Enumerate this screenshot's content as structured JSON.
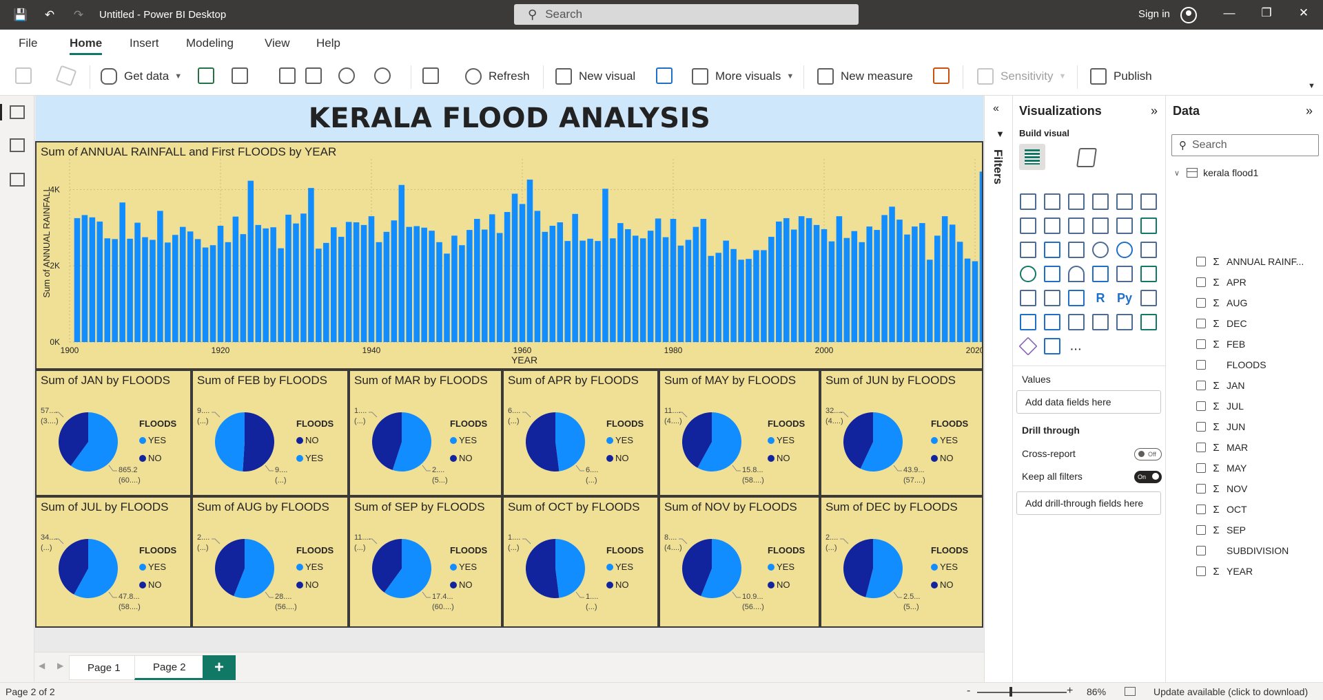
{
  "window": {
    "title": "Untitled - Power BI Desktop",
    "search_placeholder": "Search",
    "sign_in": "Sign in",
    "minimize": "—",
    "restore": "❐",
    "close": "✕"
  },
  "menu": [
    "File",
    "Home",
    "Insert",
    "Modeling",
    "View",
    "Help"
  ],
  "ribbon": {
    "get_data": "Get data",
    "refresh": "Refresh",
    "new_visual": "New visual",
    "more_visuals": "More visuals",
    "new_measure": "New measure",
    "sensitivity": "Sensitivity",
    "publish": "Publish"
  },
  "report": {
    "banner": "KERALA FLOOD ANALYSIS",
    "bar_visual": {
      "title": "Sum of ANNUAL RAINFALL and First FLOODS by YEAR"
    },
    "pies": [
      {
        "title": "Sum of JAN by FLOODS",
        "legend_title": "FLOODS",
        "legend": [
          "YES",
          "NO"
        ],
        "label_a": [
          "57....",
          "(3....)"
        ],
        "label_b": [
          "865.2",
          "(60....)"
        ]
      },
      {
        "title": "Sum of FEB by FLOODS",
        "legend_title": "FLOODS",
        "legend": [
          "NO",
          "YES"
        ],
        "label_a": [
          "9....",
          "(...)"
        ],
        "label_b": [
          "9....",
          "(...)"
        ]
      },
      {
        "title": "Sum of MAR by FLOODS",
        "legend_title": "FLOODS",
        "legend": [
          "YES",
          "NO"
        ],
        "label_a": [
          "1....",
          "(...)"
        ],
        "label_b": [
          "2....",
          "(5...)"
        ]
      },
      {
        "title": "Sum of APR by FLOODS",
        "legend_title": "FLOODS",
        "legend": [
          "YES",
          "NO"
        ],
        "label_a": [
          "6....",
          "(...)"
        ],
        "label_b": [
          "6....",
          "(...)"
        ]
      },
      {
        "title": "Sum of MAY by FLOODS",
        "legend_title": "FLOODS",
        "legend": [
          "YES",
          "NO"
        ],
        "label_a": [
          "11....",
          "(4....)"
        ],
        "label_b": [
          "15.8...",
          "(58....)"
        ]
      },
      {
        "title": "Sum of JUN by FLOODS",
        "legend_title": "FLOODS",
        "legend": [
          "YES",
          "NO"
        ],
        "label_a": [
          "32....",
          "(4....)"
        ],
        "label_b": [
          "43.9...",
          "(57....)"
        ]
      },
      {
        "title": "Sum of JUL by FLOODS",
        "legend_title": "FLOODS",
        "legend": [
          "YES",
          "NO"
        ],
        "label_a": [
          "34....",
          "(...)"
        ],
        "label_b": [
          "47.8...",
          "(58....)"
        ]
      },
      {
        "title": "Sum of AUG by FLOODS",
        "legend_title": "FLOODS",
        "legend": [
          "YES",
          "NO"
        ],
        "label_a": [
          "2....",
          "(...)"
        ],
        "label_b": [
          "28....",
          "(56....)"
        ]
      },
      {
        "title": "Sum of SEP by FLOODS",
        "legend_title": "FLOODS",
        "legend": [
          "YES",
          "NO"
        ],
        "label_a": [
          "11....",
          "(...)"
        ],
        "label_b": [
          "17.4...",
          "(60....)"
        ]
      },
      {
        "title": "Sum of OCT by FLOODS",
        "legend_title": "FLOODS",
        "legend": [
          "YES",
          "NO"
        ],
        "label_a": [
          "1....",
          "(...)"
        ],
        "label_b": [
          "1....",
          "(...)"
        ]
      },
      {
        "title": "Sum of NOV by FLOODS",
        "legend_title": "FLOODS",
        "legend": [
          "YES",
          "NO"
        ],
        "label_a": [
          "8....",
          "(4....)"
        ],
        "label_b": [
          "10.9...",
          "(56....)"
        ]
      },
      {
        "title": "Sum of DEC by FLOODS",
        "legend_title": "FLOODS",
        "legend": [
          "YES",
          "NO"
        ],
        "label_a": [
          "2....",
          "(...)"
        ],
        "label_b": [
          "2.5...",
          "(5...)"
        ]
      }
    ]
  },
  "colors": {
    "series_yes": "#118dff",
    "series_no": "#12239e",
    "bar": "#118dff",
    "visual_bg": "#f0e096",
    "banner_bg": "#cfe7fb",
    "accent": "#117865"
  },
  "chart_data": [
    {
      "type": "bar",
      "title": "Sum of ANNUAL RAINFALL and First FLOODS by YEAR",
      "xlabel": "YEAR",
      "ylabel": "Sum of ANNUAL RAINFALL",
      "x_ticks": [
        "1900",
        "1920",
        "1940",
        "1960",
        "1980",
        "2000",
        "2020"
      ],
      "y_ticks": [
        "0K",
        "2K",
        "4K"
      ],
      "xlim": [
        1900,
        2020
      ],
      "ylim": [
        0,
        4800
      ],
      "grid": true,
      "x_start": 1901,
      "values": [
        3250,
        3330,
        3270,
        3160,
        2720,
        2700,
        3660,
        2710,
        3130,
        2750,
        2680,
        3440,
        2610,
        2810,
        3020,
        2900,
        2700,
        2480,
        2540,
        3050,
        2620,
        3290,
        2830,
        4230,
        3070,
        2980,
        3010,
        2460,
        3340,
        3110,
        3370,
        4040,
        2450,
        2600,
        3010,
        2760,
        3150,
        3140,
        3070,
        3300,
        2620,
        2890,
        3190,
        4120,
        3020,
        3040,
        3000,
        2920,
        2620,
        2320,
        2790,
        2540,
        2940,
        3230,
        2950,
        3350,
        2860,
        3410,
        3890,
        3620,
        4260,
        3440,
        2890,
        3050,
        3140,
        2650,
        3360,
        2660,
        2710,
        2650,
        4020,
        2720,
        3120,
        2960,
        2790,
        2720,
        2920,
        3240,
        2750,
        3230,
        2530,
        2680,
        3020,
        3230,
        2260,
        2340,
        2660,
        2440,
        2160,
        2180,
        2410,
        2410,
        2760,
        3160,
        3250,
        2950,
        3300,
        3250,
        3070,
        2960,
        2640,
        3300,
        2730,
        2910,
        2620,
        3030,
        2940,
        3330,
        3550,
        3210,
        2820,
        3030,
        3120,
        2160,
        2790,
        3300,
        3080,
        2630,
        2190,
        2120,
        4470
      ]
    },
    {
      "type": "pie",
      "title": "Sum of JAN by FLOODS",
      "labels": [
        "YES",
        "NO"
      ],
      "values": [
        60,
        40
      ]
    },
    {
      "type": "pie",
      "title": "Sum of FEB by FLOODS",
      "labels": [
        "NO",
        "YES"
      ],
      "values": [
        51,
        49
      ]
    },
    {
      "type": "pie",
      "title": "Sum of MAR by FLOODS",
      "labels": [
        "YES",
        "NO"
      ],
      "values": [
        55,
        45
      ]
    },
    {
      "type": "pie",
      "title": "Sum of APR by FLOODS",
      "labels": [
        "YES",
        "NO"
      ],
      "values": [
        48,
        52
      ]
    },
    {
      "type": "pie",
      "title": "Sum of MAY by FLOODS",
      "labels": [
        "YES",
        "NO"
      ],
      "values": [
        58,
        42
      ]
    },
    {
      "type": "pie",
      "title": "Sum of JUN by FLOODS",
      "labels": [
        "YES",
        "NO"
      ],
      "values": [
        57,
        43
      ]
    },
    {
      "type": "pie",
      "title": "Sum of JUL by FLOODS",
      "labels": [
        "YES",
        "NO"
      ],
      "values": [
        58,
        42
      ]
    },
    {
      "type": "pie",
      "title": "Sum of AUG by FLOODS",
      "labels": [
        "YES",
        "NO"
      ],
      "values": [
        56,
        44
      ]
    },
    {
      "type": "pie",
      "title": "Sum of SEP by FLOODS",
      "labels": [
        "YES",
        "NO"
      ],
      "values": [
        60,
        40
      ]
    },
    {
      "type": "pie",
      "title": "Sum of OCT by FLOODS",
      "labels": [
        "YES",
        "NO"
      ],
      "values": [
        48,
        52
      ]
    },
    {
      "type": "pie",
      "title": "Sum of NOV by FLOODS",
      "labels": [
        "YES",
        "NO"
      ],
      "values": [
        56,
        44
      ]
    },
    {
      "type": "pie",
      "title": "Sum of DEC by FLOODS",
      "labels": [
        "YES",
        "NO"
      ],
      "values": [
        54,
        46
      ]
    }
  ],
  "pages": {
    "tabs": [
      "Page 1",
      "Page 2"
    ],
    "active": "Page 2",
    "add": "+"
  },
  "status": {
    "page_info": "Page 2 of 2",
    "zoom": "86%",
    "zoom_level_percent": 86,
    "update": "Update available (click to download)",
    "minus": "-",
    "plus": "+"
  },
  "filters": {
    "label": "Filters",
    "collapse": "«"
  },
  "visualizations": {
    "title": "Visualizations",
    "expand": "»",
    "build_visual": "Build visual",
    "values_label": "Values",
    "values_placeholder": "Add data fields here",
    "drill_through": "Drill through",
    "cross_report": "Cross-report",
    "cross_report_state": "Off",
    "keep_all_filters": "Keep all filters",
    "keep_all_filters_state": "On",
    "drill_placeholder": "Add drill-through fields here",
    "more": "···"
  },
  "data_pane": {
    "title": "Data",
    "expand": "»",
    "search_placeholder": "Search",
    "table": "kerala flood1",
    "fields": [
      {
        "name": "ANNUAL RAINF...",
        "sigma": true
      },
      {
        "name": "APR",
        "sigma": true
      },
      {
        "name": "AUG",
        "sigma": true
      },
      {
        "name": "DEC",
        "sigma": true
      },
      {
        "name": "FEB",
        "sigma": true
      },
      {
        "name": "FLOODS",
        "sigma": false
      },
      {
        "name": "JAN",
        "sigma": true
      },
      {
        "name": "JUL",
        "sigma": true
      },
      {
        "name": "JUN",
        "sigma": true
      },
      {
        "name": "MAR",
        "sigma": true
      },
      {
        "name": "MAY",
        "sigma": true
      },
      {
        "name": "NOV",
        "sigma": true
      },
      {
        "name": "OCT",
        "sigma": true
      },
      {
        "name": "SEP",
        "sigma": true
      },
      {
        "name": "SUBDIVISION",
        "sigma": false
      },
      {
        "name": "YEAR",
        "sigma": true
      }
    ]
  }
}
